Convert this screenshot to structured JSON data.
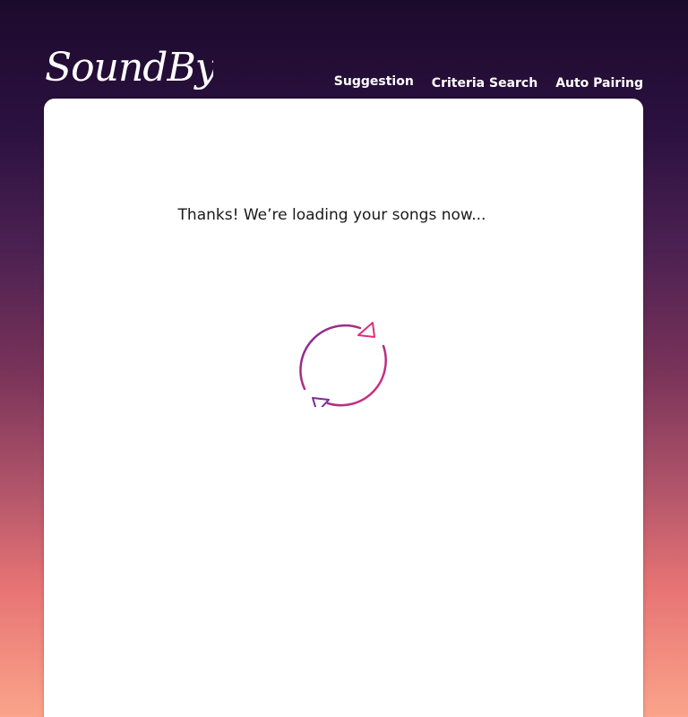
{
  "header": {
    "logo_text": "SoundByte",
    "nav": {
      "suggestion": "Suggestion",
      "criteria_search": "Criteria Search",
      "auto_pairing": "Auto Pairing"
    }
  },
  "main": {
    "message": "Thanks! We’re loading your songs now...",
    "spinner_icon": "refresh-cycle-icon"
  },
  "colors": {
    "accent_pink": "#e0307a",
    "accent_purple": "#7a2c90",
    "background_top": "#1c0a2c",
    "background_bottom": "#fba48a"
  }
}
